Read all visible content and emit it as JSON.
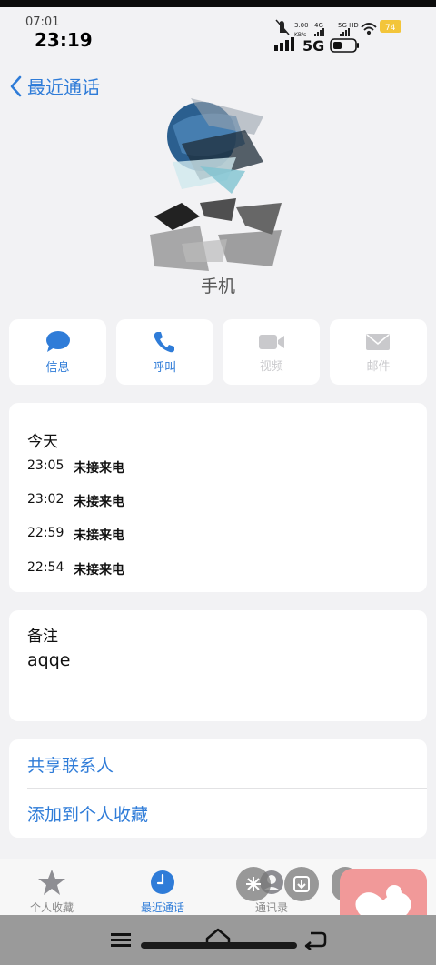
{
  "status_bar": {
    "small_time": "07:01",
    "time": "23:19",
    "speed": "3.00",
    "speed_unit": "KB/s",
    "net_4g": "4G",
    "net_5ghd": "5G HD",
    "network": "5G",
    "battery_badge": "74"
  },
  "nav": {
    "back_label": "最近通话"
  },
  "contact": {
    "name": "手机"
  },
  "actions": [
    {
      "label": "信息",
      "icon": "message-bubble-icon",
      "enabled": true
    },
    {
      "label": "呼叫",
      "icon": "phone-icon",
      "enabled": true
    },
    {
      "label": "视频",
      "icon": "video-camera-icon",
      "enabled": false
    },
    {
      "label": "邮件",
      "icon": "mail-icon",
      "enabled": false
    }
  ],
  "calls": {
    "day_label": "今天",
    "items": [
      {
        "time": "23:05",
        "status": "未接来电"
      },
      {
        "time": "23:02",
        "status": "未接来电"
      },
      {
        "time": "22:59",
        "status": "未接来电"
      },
      {
        "time": "22:54",
        "status": "未接来电"
      }
    ]
  },
  "notes": {
    "label": "备注",
    "value": "aqqe"
  },
  "links": {
    "share": "共享联系人",
    "favorite": "添加到个人收藏"
  },
  "tabs": [
    {
      "label": "个人收藏",
      "icon": "star-icon",
      "active": false
    },
    {
      "label": "最近通话",
      "icon": "clock-icon",
      "active": true
    },
    {
      "label": "通讯录",
      "icon": "contacts-icon",
      "active": false
    }
  ],
  "colors": {
    "accent": "#2f7cd8",
    "background": "#f2f2f4",
    "widget": "#f19999"
  }
}
